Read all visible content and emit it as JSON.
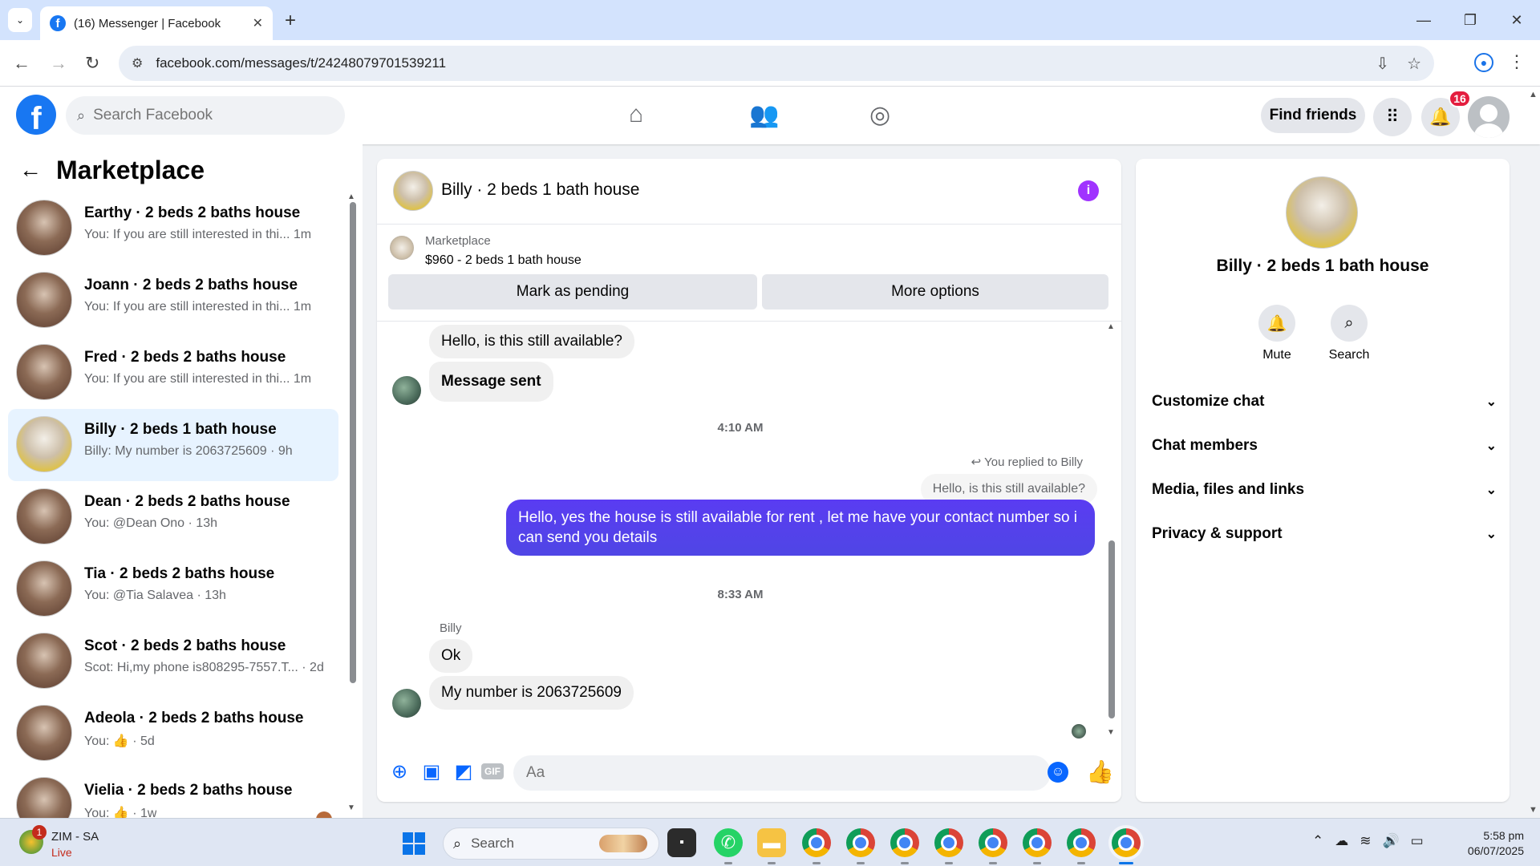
{
  "browser": {
    "tab_title": "(16) Messenger | Facebook",
    "url": "facebook.com/messages/t/24248079701539211"
  },
  "fb": {
    "search_placeholder": "Search Facebook",
    "find_friends": "Find friends",
    "notification_count": "16"
  },
  "sidebar": {
    "title": "Marketplace",
    "conversations": [
      {
        "name": "Earthy · 2 beds 2 baths house",
        "preview": "You: If you are still interested in thi...",
        "time": "1m"
      },
      {
        "name": "Joann · 2 beds 2 baths house",
        "preview": "You: If you are still interested in thi...",
        "time": "1m"
      },
      {
        "name": "Fred · 2 beds 2 baths house",
        "preview": "You: If you are still interested in thi...",
        "time": "1m"
      },
      {
        "name": "Billy · 2 beds 1 bath house",
        "preview": "Billy: My number is 2063725609 · 9h"
      },
      {
        "name": "Dean · 2 beds 2 baths house",
        "preview": "You: @Dean Ono · 13h"
      },
      {
        "name": "Tia · 2 beds 2 baths house",
        "preview": "You: @Tia Salavea · 13h"
      },
      {
        "name": "Scot · 2 beds 2 baths house",
        "preview": "Scot: Hi,my phone is808295-7557.T... · 2d"
      },
      {
        "name": "Adeola · 2 beds 2 baths house",
        "preview": "You: 👍 · 5d"
      },
      {
        "name": "Vielia · 2 beds 2 baths house",
        "preview": "You: 👍 · 1w"
      }
    ]
  },
  "chat": {
    "title": "Billy · 2 beds 1 bath house",
    "marketplace_label": "Marketplace",
    "listing": "$960 - 2 beds 1 bath house",
    "mark_pending": "Mark as pending",
    "more_options": "More options",
    "messages": {
      "m1": "Hello, is this still available?",
      "m2": "Message sent",
      "time1": "4:10 AM",
      "reply_note": "You replied to Billy",
      "reply_quote": "Hello, is this still available?",
      "out1": "Hello, yes the house is still available for  rent , let me have your contact number so i can send you details",
      "time2": "8:33 AM",
      "sender": "Billy",
      "m3": "Ok",
      "m4": "My number is 2063725609"
    },
    "composer_placeholder": "Aa",
    "gif_label": "GIF"
  },
  "info_panel": {
    "name": "Billy · 2 beds 1 bath house",
    "mute": "Mute",
    "search": "Search",
    "rows": [
      "Customize chat",
      "Chat members",
      "Media, files and links",
      "Privacy & support"
    ]
  },
  "taskbar": {
    "weather_title": "ZIM - SA",
    "weather_sub": "Live",
    "weather_badge": "1",
    "search_label": "Search",
    "time": "5:58 pm",
    "date": "06/07/2025"
  },
  "colors": {
    "fb_blue": "#1877f2",
    "outgoing_bubble": "#4f46e5",
    "info_icon": "#a033ff",
    "badge_red": "#e41e3f"
  }
}
